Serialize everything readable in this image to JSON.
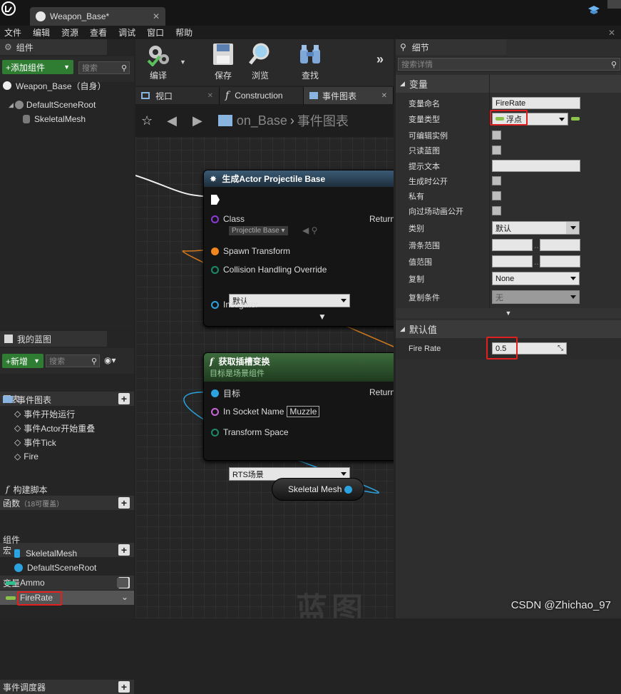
{
  "window": {
    "tab_title": "Weapon_Base*"
  },
  "menu": [
    "文件",
    "编辑",
    "资源",
    "查看",
    "调试",
    "窗口",
    "帮助"
  ],
  "components_panel": {
    "title": "组件",
    "add_button": "+添加组件",
    "search_placeholder": "搜索",
    "self_item": "Weapon_Base（自身）",
    "tree": [
      "DefaultSceneRoot",
      "SkeletalMesh"
    ]
  },
  "toolbar": {
    "compile": "编译",
    "save": "保存",
    "browse": "浏览",
    "find": "查找"
  },
  "graph_tabs": [
    "视口",
    "Construction",
    "事件图表"
  ],
  "breadcrumb": {
    "blueprint": "on_Base",
    "graph": "事件图表"
  },
  "nodes": {
    "spawn": {
      "title": "生成Actor Projectile Base",
      "class_label": "Class",
      "class_value": "Projectile Base",
      "return_label": "Return",
      "spawn_transform": "Spawn Transform",
      "collision_label": "Collision Handling Override",
      "collision_value": "默认",
      "instigator": "Instigator"
    },
    "socket": {
      "title": "获取插槽变换",
      "subtitle": "目标是场景组件",
      "target": "目标",
      "return_label": "Return",
      "socket_name_label": "In Socket Name",
      "socket_name_value": "Muzzle",
      "space_label": "Transform Space",
      "space_value": "RTS场景"
    },
    "mesh_ref": "Skeletal Mesh"
  },
  "my_blueprint": {
    "title": "我的蓝图",
    "new_button": "+新增",
    "search_placeholder": "搜索",
    "graphs_cat": "图表",
    "event_graph": "事件图表",
    "events": [
      "事件开始运行",
      "事件Actor开始重叠",
      "事件Tick",
      "Fire"
    ],
    "functions_cat": "函数",
    "functions_note": "（18可覆盖）",
    "construction": "构建脚本",
    "macros_cat": "宏",
    "variables_cat": "变量",
    "components_sub": "组件",
    "component_vars": [
      "SkeletalMesh",
      "DefaultSceneRoot"
    ],
    "vars": [
      "Ammo",
      "FireRate"
    ],
    "dispatchers_cat": "事件调度器"
  },
  "details": {
    "title": "细节",
    "search_placeholder": "搜索详情",
    "variable_section": "变量",
    "rows": [
      {
        "label": "变量命名",
        "value": "FireRate"
      },
      {
        "label": "变量类型",
        "value": "浮点"
      },
      {
        "label": "可编辑实例"
      },
      {
        "label": "只读蓝图"
      },
      {
        "label": "提示文本",
        "value": ""
      },
      {
        "label": "生成时公开"
      },
      {
        "label": "私有"
      },
      {
        "label": "向过场动画公开"
      },
      {
        "label": "类别",
        "value": "默认"
      },
      {
        "label": "滑条范围"
      },
      {
        "label": "值范围"
      },
      {
        "label": "复制",
        "value": "None"
      },
      {
        "label": "复制条件",
        "value": "无"
      }
    ],
    "default_section": "默认值",
    "default_label": "Fire Rate",
    "default_value": "0.5"
  },
  "watermark": "CSDN @Zhichao_97",
  "graph_watermark": "蓝图",
  "colors": {
    "accent_green": "#2e7d32",
    "highlight_red": "#e02020",
    "float_pin": "#8bc34a"
  }
}
